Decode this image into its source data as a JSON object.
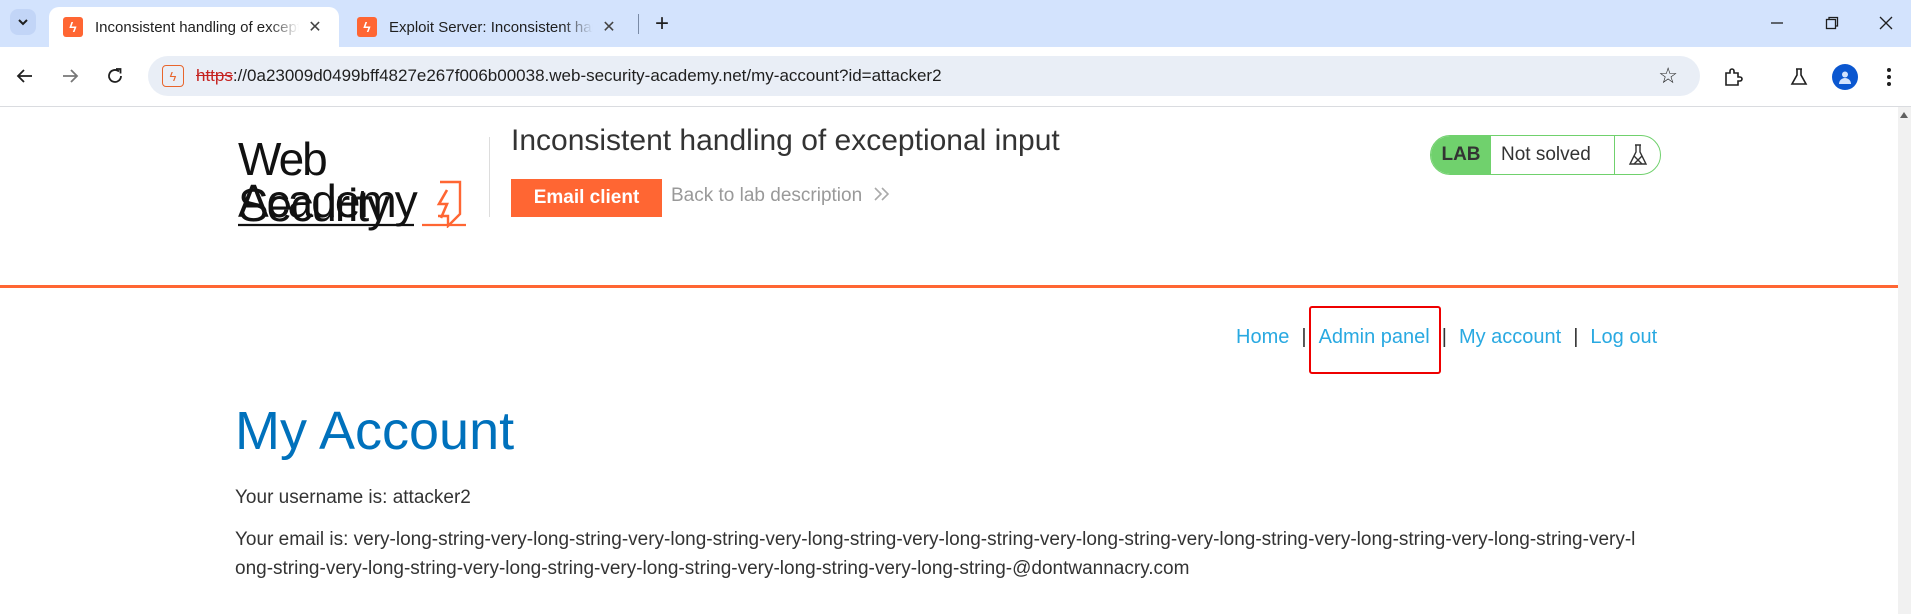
{
  "browser": {
    "tabs": [
      {
        "title": "Inconsistent handling of exceptional input",
        "active": true
      },
      {
        "title": "Exploit Server: Inconsistent handling of exceptional input",
        "active": false
      }
    ],
    "url_scheme": "https",
    "url_rest": "://0a23009d0499bff4827e267f006b00038.web-security-academy.net/my-account?id=attacker2"
  },
  "header": {
    "logo_line1": "Web Security",
    "logo_line2": "Academy",
    "lab_title": "Inconsistent handling of exceptional input",
    "email_client_label": "Email client",
    "back_link_label": "Back to lab description",
    "lab_badge": "LAB",
    "lab_status": "Not solved"
  },
  "nav": {
    "home": "Home",
    "admin_panel": "Admin panel",
    "my_account": "My account",
    "log_out": "Log out",
    "separator": "|"
  },
  "account": {
    "heading": "My Account",
    "username_line": "Your username is: attacker2",
    "email_line": "Your email is: very-long-string-very-long-string-very-long-string-very-long-string-very-long-string-very-long-string-very-long-string-very-long-string-very-long-string-very-long-string-very-long-string-very-long-string-very-long-string-very-long-string-very-long-string-@dontwannacry.com"
  },
  "colors": {
    "accent_orange": "#ff6633",
    "link_blue": "#29a9e1",
    "heading_blue": "#0071bc",
    "lab_green": "#70d16d",
    "highlight_red": "#ee0000"
  }
}
